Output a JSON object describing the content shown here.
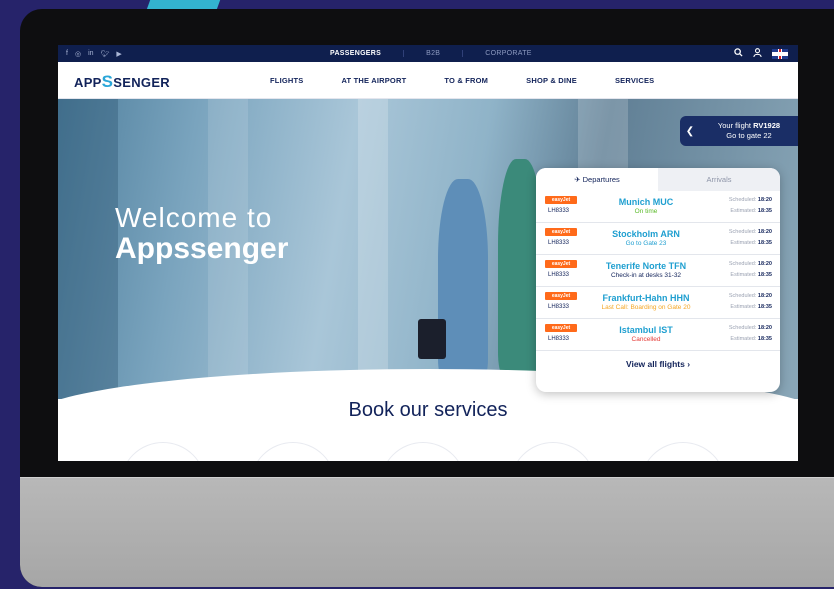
{
  "topbar": {
    "social": [
      "f",
      "◎",
      "in",
      "♥",
      "▶"
    ],
    "tabs": [
      "PASSENGERS",
      "B2B",
      "CORPORATE"
    ]
  },
  "nav": {
    "logo_prefix": "APP",
    "logo_s": "S",
    "logo_suffix": "SENGER",
    "menu": [
      "FLIGHTS",
      "AT THE AIRPORT",
      "TO & FROM",
      "SHOP & DINE",
      "SERVICES"
    ]
  },
  "hero": {
    "line1": "Welcome to",
    "line2": "Appssenger"
  },
  "flight_chip": {
    "line1_prefix": "Your flight ",
    "flight": "RV1928",
    "line2": "Go to gate 22"
  },
  "flights_panel": {
    "tab_departures": "✈ Departures",
    "tab_arrivals": "Arrivals",
    "rows": [
      {
        "airline": "easyJet",
        "code": "LH8333",
        "dest": "Munich MUC",
        "status": "On time",
        "status_color": "#5bbb2a",
        "sched_label": "Scheduled:",
        "sched": "18:20",
        "est_label": "Estimated:",
        "est": "18:35"
      },
      {
        "airline": "easyJet",
        "code": "LH8333",
        "dest": "Stockholm ARN",
        "status": "Go to Gate 23",
        "status_color": "#1f9fd0",
        "sched_label": "Scheduled:",
        "sched": "18:20",
        "est_label": "Estimated:",
        "est": "18:35"
      },
      {
        "airline": "easyJet",
        "code": "LH8333",
        "dest": "Tenerife Norte TFN",
        "status": "Check-in at desks 31-32",
        "status_color": "#12235a",
        "sched_label": "Scheduled:",
        "sched": "18:20",
        "est_label": "Estimated:",
        "est": "18:35"
      },
      {
        "airline": "easyJet",
        "code": "LH8333",
        "dest": "Frankfurt-Hahn HHN",
        "status": "Last Call: Boarding on Gate 20",
        "status_color": "#f5a623",
        "sched_label": "Scheduled:",
        "sched": "18:20",
        "est_label": "Estimated:",
        "est": "18:35"
      },
      {
        "airline": "easyJet",
        "code": "LH8333",
        "dest": "Istambul IST",
        "status": "Cancelled",
        "status_color": "#e53935",
        "sched_label": "Scheduled:",
        "sched": "18:20",
        "est_label": "Estimated:",
        "est": "18:35"
      }
    ],
    "view_all": "View all flights ›"
  },
  "book": {
    "title": "Book our services"
  },
  "colors": {
    "navy": "#12235a",
    "accent": "#2aa6d8",
    "easyjet": "#ff6a1a"
  }
}
